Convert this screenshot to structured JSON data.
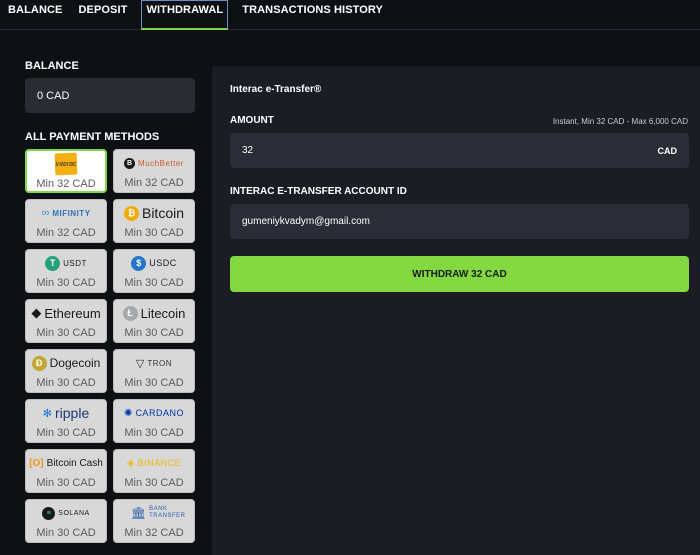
{
  "tabs": [
    {
      "label": "BALANCE"
    },
    {
      "label": "DEPOSIT"
    },
    {
      "label": "WITHDRAWAL"
    },
    {
      "label": "TRANSACTIONS HISTORY"
    }
  ],
  "balance": {
    "label": "BALANCE",
    "value": "0 CAD"
  },
  "methods": {
    "label": "ALL PAYMENT METHODS",
    "items": [
      {
        "logo_text": "interac",
        "min": "Min 32 CAD"
      },
      {
        "logo_text": "MuchBetter",
        "min": "Min 32 CAD"
      },
      {
        "logo_text": "MIFINITY",
        "min": "Min 32 CAD"
      },
      {
        "logo_text": "Bitcoin",
        "min": "Min 30 CAD"
      },
      {
        "logo_text": "USDT",
        "min": "Min 30 CAD"
      },
      {
        "logo_text": "USDC",
        "min": "Min 30 CAD"
      },
      {
        "logo_text": "Ethereum",
        "min": "Min 30 CAD"
      },
      {
        "logo_text": "Litecoin",
        "min": "Min 30 CAD"
      },
      {
        "logo_text": "Dogecoin",
        "min": "Min 30 CAD"
      },
      {
        "logo_text": "TRON",
        "min": "Min 30 CAD"
      },
      {
        "logo_text": "ripple",
        "min": "Min 30 CAD"
      },
      {
        "logo_text": "CARDANO",
        "min": "Min 30 CAD"
      },
      {
        "logo_text": "Bitcoin Cash",
        "min": "Min 30 CAD"
      },
      {
        "logo_text": "BINANCE",
        "min": "Min 30 CAD"
      },
      {
        "logo_text": "SOLANA",
        "min": "Min 30 CAD"
      },
      {
        "logo_text": "BANK TRANSFER",
        "min": "Min 32 CAD"
      }
    ]
  },
  "panel": {
    "title": "Interac e-Transfer®",
    "amount": {
      "label": "AMOUNT",
      "hint": "Instant, Min 32 CAD - Max 6,000 CAD",
      "value": "32",
      "currency": "CAD"
    },
    "account": {
      "label": "INTERAC E-TRANSFER ACCOUNT ID",
      "value": "gumeniykvadym@gmail.com"
    },
    "button_label": "WITHDRAW 32 CAD"
  },
  "colors": {
    "accent": "#84d83f",
    "panel": "#1c1d24",
    "background": "#0f1014"
  }
}
